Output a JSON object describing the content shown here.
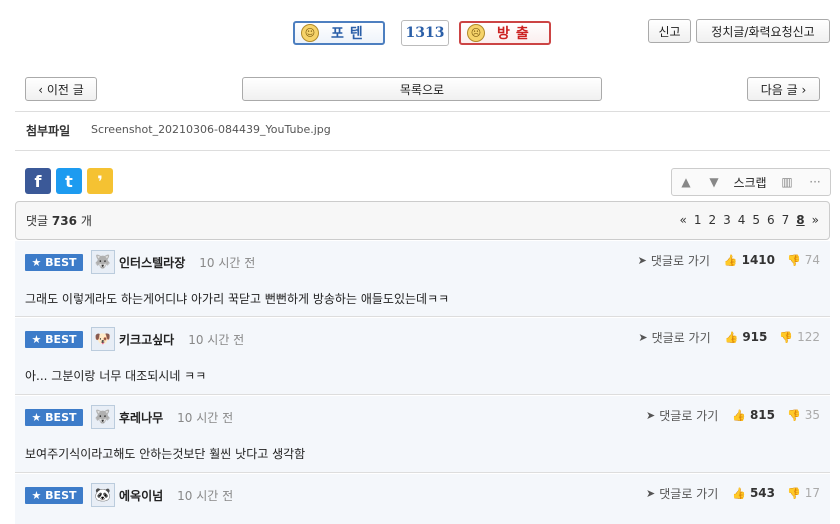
{
  "vote": {
    "up_label": "포텐",
    "count": "1313",
    "down_label": "방출"
  },
  "top_buttons": {
    "report": "신고",
    "political_report": "정치글/화력요청신고"
  },
  "nav": {
    "prev": "‹ 이전 글",
    "list": "목록으로",
    "next": "다음 글 ›"
  },
  "attachment": {
    "label": "첨부파일",
    "filename": "Screenshot_20210306-084439_YouTube.jpg"
  },
  "share": {
    "facebook": "f",
    "twitter": "t",
    "kakao": "❜"
  },
  "tools": {
    "scrap": "스크랩"
  },
  "comments_header": {
    "label": "댓글",
    "count": "736",
    "unit": "개",
    "pager": [
      "«",
      "1",
      "2",
      "3",
      "4",
      "5",
      "6",
      "7",
      "8",
      "»"
    ],
    "current_page": "8"
  },
  "comments": [
    {
      "badge": "★ BEST",
      "nick": "인터스텔라장",
      "time": "10 시간 전",
      "goto": "댓글로 가기",
      "up": "1410",
      "down": "74",
      "text": "그래도 이렇게라도 하는게어디냐 아가리 꾹닫고 뻔뻔하게 방송하는 애들도있는데ㅋㅋ"
    },
    {
      "badge": "★ BEST",
      "nick": "키크고싶다",
      "time": "10 시간 전",
      "goto": "댓글로 가기",
      "up": "915",
      "down": "122",
      "text": "아... 그분이랑 너무 대조되시네 ㅋㅋ"
    },
    {
      "badge": "★ BEST",
      "nick": "후레나무",
      "time": "10 시간 전",
      "goto": "댓글로 가기",
      "up": "815",
      "down": "35",
      "text": "보여주기식이라고해도 안하는것보단 훨씬 낫다고 생각함"
    },
    {
      "badge": "★ BEST",
      "nick": "에옥이넘",
      "time": "10 시간 전",
      "goto": "댓글로 가기",
      "up": "543",
      "down": "17",
      "text": ""
    }
  ]
}
